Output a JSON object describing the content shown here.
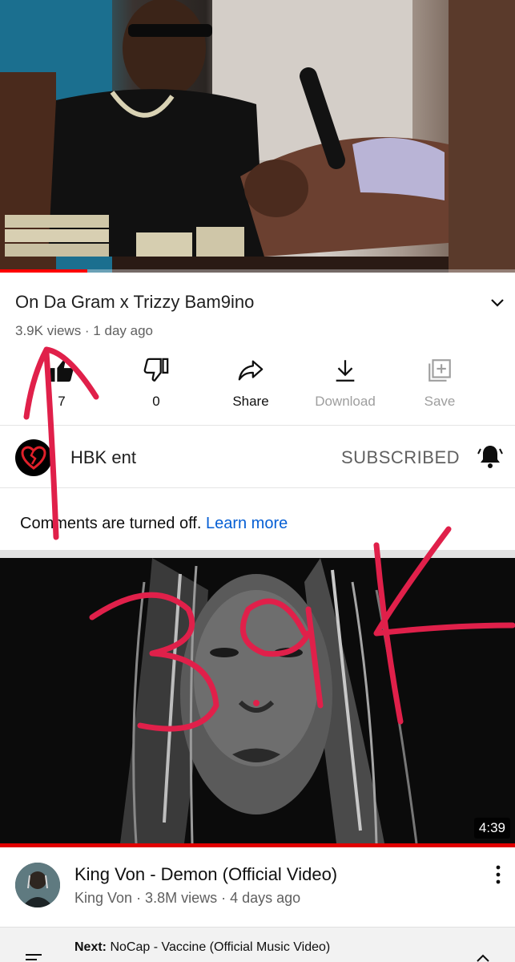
{
  "video": {
    "title": "On Da Gram x Trizzy Bam9ino",
    "meta": "3.9K views · 1 day ago",
    "progress": 0.17
  },
  "actions": {
    "like_count": "7",
    "dislike_count": "0",
    "share_label": "Share",
    "download_label": "Download",
    "save_label": "Save"
  },
  "channel": {
    "name": "HBK ent",
    "subscribe_state": "SUBSCRIBED"
  },
  "comments": {
    "text": "Comments are turned off.",
    "link": "Learn more"
  },
  "up_next": {
    "duration": "4:39",
    "title": "King Von - Demon (Official Video)",
    "meta": "King Von · 3.8M views · 4 days ago"
  },
  "queue": {
    "prefix": "Next:",
    "title": "NoCap - Vaccine (Official Music Video)"
  },
  "annotation": {
    "text": "39K",
    "color": "#e0204a"
  },
  "colors": {
    "accent": "#ff0000",
    "link": "#065fd4",
    "secondary_text": "#606060"
  }
}
